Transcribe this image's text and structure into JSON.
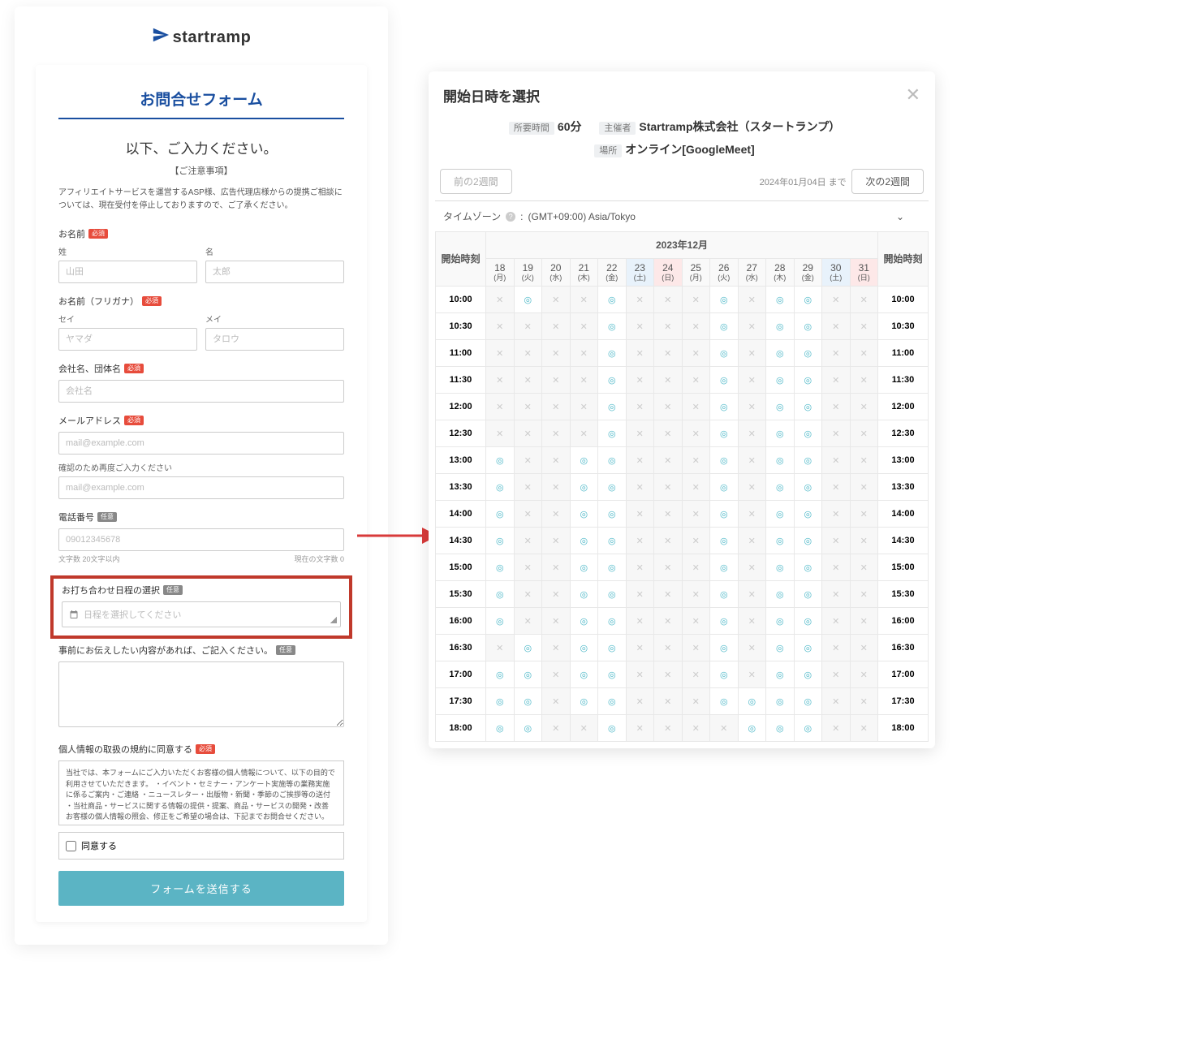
{
  "logo": {
    "text": "startramp"
  },
  "form": {
    "title": "お問合せフォーム",
    "lead": "以下、ご入力ください。",
    "note_head": "【ご注意事項】",
    "note": "アフィリエイトサービスを運営するASP様、広告代理店様からの提携ご相談については、現在受付を停止しておりますので、ご了承ください。",
    "name_label": "お名前",
    "req_badge": "必須",
    "opt_badge": "任意",
    "sei": "姓",
    "mei": "名",
    "sei_ph": "山田",
    "mei_ph": "太郎",
    "furigana_label": "お名前（フリガナ）",
    "sei_k": "セイ",
    "mei_k": "メイ",
    "sei_k_ph": "ヤマダ",
    "mei_k_ph": "タロウ",
    "company_label": "会社名、団体名",
    "company_ph": "会社名",
    "email_label": "メールアドレス",
    "email_ph": "mail@example.com",
    "email_confirm": "確認のため再度ご入力ください",
    "tel_label": "電話番号",
    "tel_ph": "09012345678",
    "tel_help_l": "文字数 20文字以内",
    "tel_help_r": "現在の文字数 0",
    "date_label": "お打ち合わせ日程の選択",
    "date_ph": "日程を選択してください",
    "msg_label": "事前にお伝えしたい内容があれば、ご記入ください。",
    "privacy_label": "個人情報の取扱の規約に同意する",
    "privacy_text": "当社では、本フォームにご入力いただくお客様の個人情報について、以下の目的で利用させていただきます。\n\n・イベント・セミナー・アンケート実施等の業務実施に係るご案内・ご連絡\n・ニュースレター・出版物・新聞・季節のご挨拶等の送付\n・当社商品・サービスに関する情報の提供・提案、商品・サービスの開発・改善\n\nお客様の個人情報の照会、修正をご希望の場合は、下記までお問合せください。",
    "agree": "同意する",
    "submit": "フォームを送信する"
  },
  "calendar": {
    "title": "開始日時を選択",
    "duration_tag": "所要時間",
    "duration": "60分",
    "host_tag": "主催者",
    "host": "Startramp株式会社（スタートランプ）",
    "place_tag": "場所",
    "place": "オンライン[GoogleMeet]",
    "prev": "前の2週間",
    "until": "2024年01月04日 まで",
    "next": "次の2週間",
    "tz_label": "タイムゾーン",
    "tz_value": "(GMT+09:00) Asia/Tokyo",
    "month": "2023年12月",
    "time_hdr": "開始時刻",
    "days": [
      {
        "d": "18",
        "w": "(月)",
        "cls": ""
      },
      {
        "d": "19",
        "w": "(火)",
        "cls": ""
      },
      {
        "d": "20",
        "w": "(水)",
        "cls": ""
      },
      {
        "d": "21",
        "w": "(木)",
        "cls": ""
      },
      {
        "d": "22",
        "w": "(金)",
        "cls": ""
      },
      {
        "d": "23",
        "w": "(土)",
        "cls": "sat"
      },
      {
        "d": "24",
        "w": "(日)",
        "cls": "sun"
      },
      {
        "d": "25",
        "w": "(月)",
        "cls": ""
      },
      {
        "d": "26",
        "w": "(火)",
        "cls": ""
      },
      {
        "d": "27",
        "w": "(水)",
        "cls": ""
      },
      {
        "d": "28",
        "w": "(木)",
        "cls": ""
      },
      {
        "d": "29",
        "w": "(金)",
        "cls": ""
      },
      {
        "d": "30",
        "w": "(土)",
        "cls": "sat"
      },
      {
        "d": "31",
        "w": "(日)",
        "cls": "sun"
      }
    ],
    "rows": [
      {
        "t": "10:00",
        "s": [
          "x",
          "o",
          "x",
          "x",
          "o",
          "x",
          "x",
          "x",
          "o",
          "x",
          "o",
          "o",
          "x",
          "x"
        ]
      },
      {
        "t": "10:30",
        "s": [
          "x",
          "x",
          "x",
          "x",
          "o",
          "x",
          "x",
          "x",
          "o",
          "x",
          "o",
          "o",
          "x",
          "x"
        ]
      },
      {
        "t": "11:00",
        "s": [
          "x",
          "x",
          "x",
          "x",
          "o",
          "x",
          "x",
          "x",
          "o",
          "x",
          "o",
          "o",
          "x",
          "x"
        ]
      },
      {
        "t": "11:30",
        "s": [
          "x",
          "x",
          "x",
          "x",
          "o",
          "x",
          "x",
          "x",
          "o",
          "x",
          "o",
          "o",
          "x",
          "x"
        ]
      },
      {
        "t": "12:00",
        "s": [
          "x",
          "x",
          "x",
          "x",
          "o",
          "x",
          "x",
          "x",
          "o",
          "x",
          "o",
          "o",
          "x",
          "x"
        ]
      },
      {
        "t": "12:30",
        "s": [
          "x",
          "x",
          "x",
          "x",
          "o",
          "x",
          "x",
          "x",
          "o",
          "x",
          "o",
          "o",
          "x",
          "x"
        ]
      },
      {
        "t": "13:00",
        "s": [
          "o",
          "x",
          "x",
          "o",
          "o",
          "x",
          "x",
          "x",
          "o",
          "x",
          "o",
          "o",
          "x",
          "x"
        ]
      },
      {
        "t": "13:30",
        "s": [
          "o",
          "x",
          "x",
          "o",
          "o",
          "x",
          "x",
          "x",
          "o",
          "x",
          "o",
          "o",
          "x",
          "x"
        ]
      },
      {
        "t": "14:00",
        "s": [
          "o",
          "x",
          "x",
          "o",
          "o",
          "x",
          "x",
          "x",
          "o",
          "x",
          "o",
          "o",
          "x",
          "x"
        ]
      },
      {
        "t": "14:30",
        "s": [
          "o",
          "x",
          "x",
          "o",
          "o",
          "x",
          "x",
          "x",
          "o",
          "x",
          "o",
          "o",
          "x",
          "x"
        ]
      },
      {
        "t": "15:00",
        "s": [
          "o",
          "x",
          "x",
          "o",
          "o",
          "x",
          "x",
          "x",
          "o",
          "x",
          "o",
          "o",
          "x",
          "x"
        ]
      },
      {
        "t": "15:30",
        "s": [
          "o",
          "x",
          "x",
          "o",
          "o",
          "x",
          "x",
          "x",
          "o",
          "x",
          "o",
          "o",
          "x",
          "x"
        ]
      },
      {
        "t": "16:00",
        "s": [
          "o",
          "x",
          "x",
          "o",
          "o",
          "x",
          "x",
          "x",
          "o",
          "x",
          "o",
          "o",
          "x",
          "x"
        ]
      },
      {
        "t": "16:30",
        "s": [
          "x",
          "o",
          "x",
          "o",
          "o",
          "x",
          "x",
          "x",
          "o",
          "x",
          "o",
          "o",
          "x",
          "x"
        ]
      },
      {
        "t": "17:00",
        "s": [
          "o",
          "o",
          "x",
          "o",
          "o",
          "x",
          "x",
          "x",
          "o",
          "x",
          "o",
          "o",
          "x",
          "x"
        ]
      },
      {
        "t": "17:30",
        "s": [
          "o",
          "o",
          "x",
          "o",
          "o",
          "x",
          "x",
          "x",
          "o",
          "o",
          "o",
          "o",
          "x",
          "x"
        ]
      },
      {
        "t": "18:00",
        "s": [
          "o",
          "o",
          "x",
          "x",
          "o",
          "x",
          "x",
          "x",
          "x",
          "o",
          "o",
          "o",
          "x",
          "x"
        ]
      }
    ]
  }
}
